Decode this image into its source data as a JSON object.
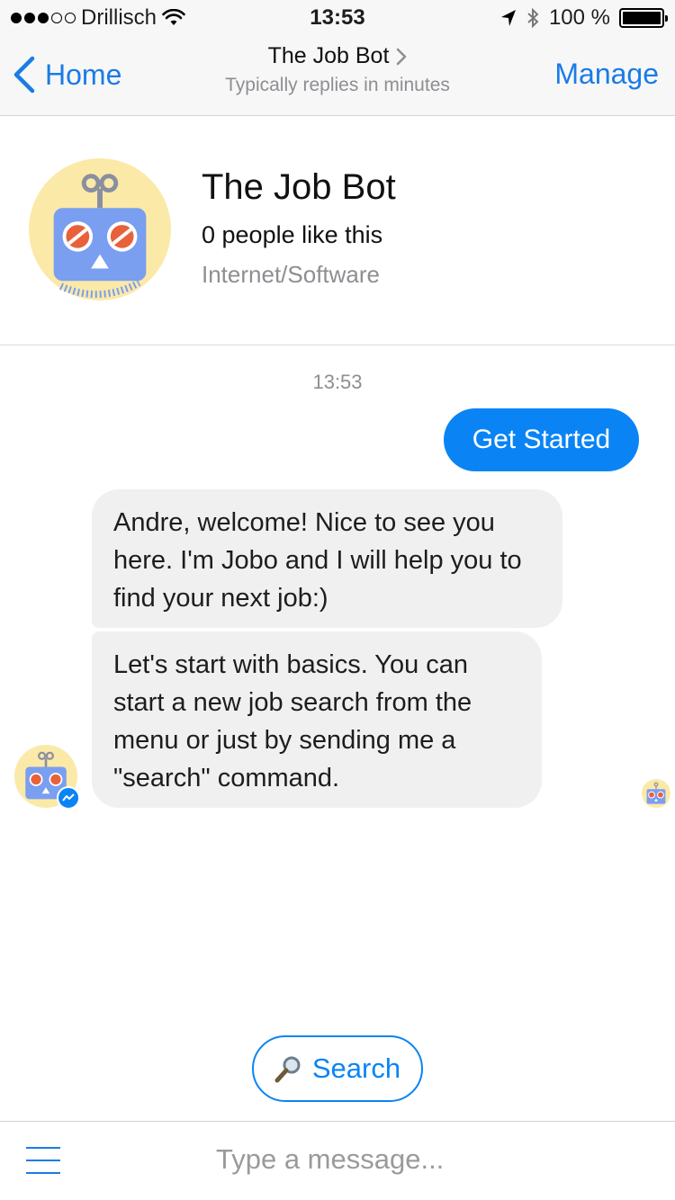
{
  "status_bar": {
    "carrier": "Drillisch",
    "time": "13:53",
    "battery_percent": "100 %",
    "signal_strength": 3,
    "signal_max": 5
  },
  "nav": {
    "back_label": "Home",
    "title": "The Job Bot",
    "subtitle": "Typically replies in minutes",
    "manage_label": "Manage"
  },
  "profile": {
    "name": "The Job Bot",
    "likes": "0 people like this",
    "category": "Internet/Software"
  },
  "chat": {
    "timestamp": "13:53",
    "sent_message": "Get Started",
    "received": [
      "Andre, welcome! Nice to see you here. I'm Jobo and I will help you to find your next job:)",
      "Let's start with basics. You can start a new job search from the menu or just by sending me a \"search\" command."
    ]
  },
  "quick_reply": {
    "label": "Search",
    "icon": "magnifier-icon"
  },
  "composer": {
    "placeholder": "Type a message..."
  },
  "colors": {
    "accent": "#0a84f5",
    "bubble_in": "#f0f0f0",
    "avatar_bg": "#fbe9a8",
    "robot_head": "#7a9ef0",
    "robot_eye": "#e8613a"
  }
}
